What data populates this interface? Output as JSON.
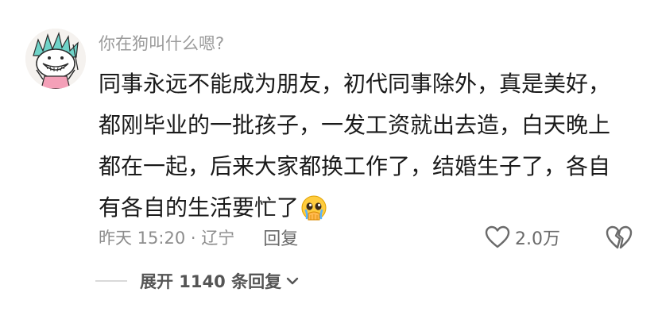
{
  "comment": {
    "username": "你在狗叫什么嗯?",
    "content_lines": [
      "同事永远不能成为朋友，初代同事除外，真是美好，",
      "都刚毕业的一批孩子，一发工资就出去造，白天晚上",
      "都在一起，后来大家都换工作了，结婚生子了，各自",
      "有各自的生活要忙了"
    ],
    "emoji": "pleading-face-emoji",
    "time_location": "昨天 15:20 · 辽宁",
    "reply_label": "回复",
    "like_count": "2.0万",
    "icons": {
      "like": "heart-outline-icon",
      "dislike": "broken-heart-icon",
      "expand": "chevron-down-icon"
    },
    "expand_label": "展开 1140 条回复"
  },
  "colors": {
    "username": "#9b9b9b",
    "text": "#1a1a1a",
    "meta": "#8c8c8c",
    "icon": "#6a6a6a"
  }
}
